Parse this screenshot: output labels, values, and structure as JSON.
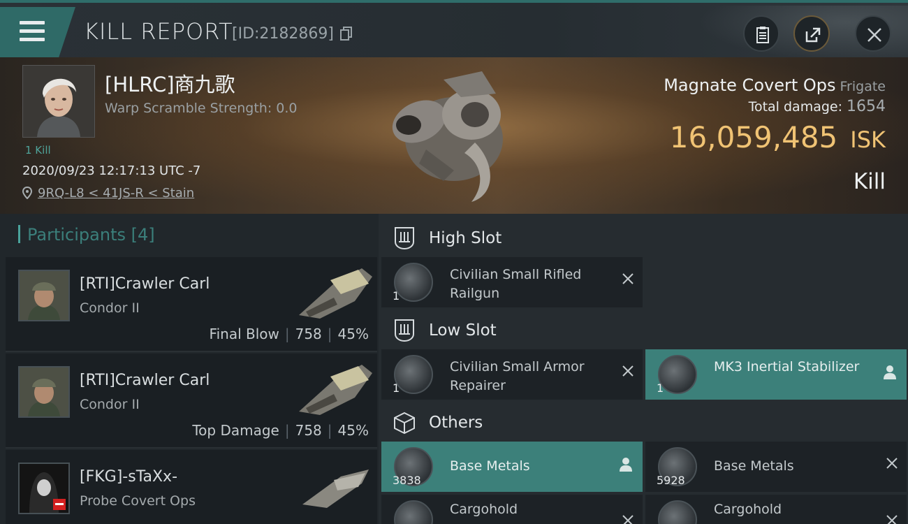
{
  "header": {
    "title": "KILL REPORT",
    "report_id": "[ID:2182869]"
  },
  "victim": {
    "name": "[HLRC]商九歌",
    "warp_scramble": "Warp Scramble Strength: 0.0",
    "kill_badge": "1 Kill",
    "datetime": "2020/09/23 12:17:13 UTC -7",
    "location": "9RQ-L8 < 41JS-R < Stain",
    "ship_name": "Magnate Covert Ops",
    "ship_class": "Frigate",
    "total_damage_label": "Total damage:",
    "total_damage": "1654",
    "isk_value": "16,059,485",
    "isk_unit": "ISK",
    "result": "Kill"
  },
  "participants": {
    "label": "Participants",
    "count": "[4]",
    "rows": [
      {
        "name": "[RTI]Crawler Carl",
        "ship": "Condor II",
        "role": "Final Blow",
        "damage": "758",
        "percent": "45%"
      },
      {
        "name": "[RTI]Crawler Carl",
        "ship": "Condor II",
        "role": "Top Damage",
        "damage": "758",
        "percent": "45%"
      },
      {
        "name": "[FKG]-sTaXx-",
        "ship": "Probe Covert Ops",
        "role": "",
        "damage": "",
        "percent": ""
      }
    ]
  },
  "fitting": {
    "high_slot": {
      "label": "High Slot",
      "items": [
        {
          "name": "Civilian Small Rifled Railgun",
          "qty": "1"
        }
      ]
    },
    "low_slot": {
      "label": "Low Slot",
      "items": [
        {
          "name": "Civilian Small Armor Repairer",
          "qty": "1"
        },
        {
          "name": "MK3 Inertial Stabilizer",
          "qty": "1"
        }
      ]
    },
    "others": {
      "label": "Others",
      "items": [
        {
          "name": "Base Metals",
          "qty": "3838"
        },
        {
          "name": "Base Metals",
          "qty": "5928"
        },
        {
          "name": "Cargohold",
          "qty": ""
        },
        {
          "name": "Cargohold",
          "qty": ""
        }
      ]
    }
  },
  "colors": {
    "accent": "#3c807a",
    "isk": "#f0c374"
  }
}
